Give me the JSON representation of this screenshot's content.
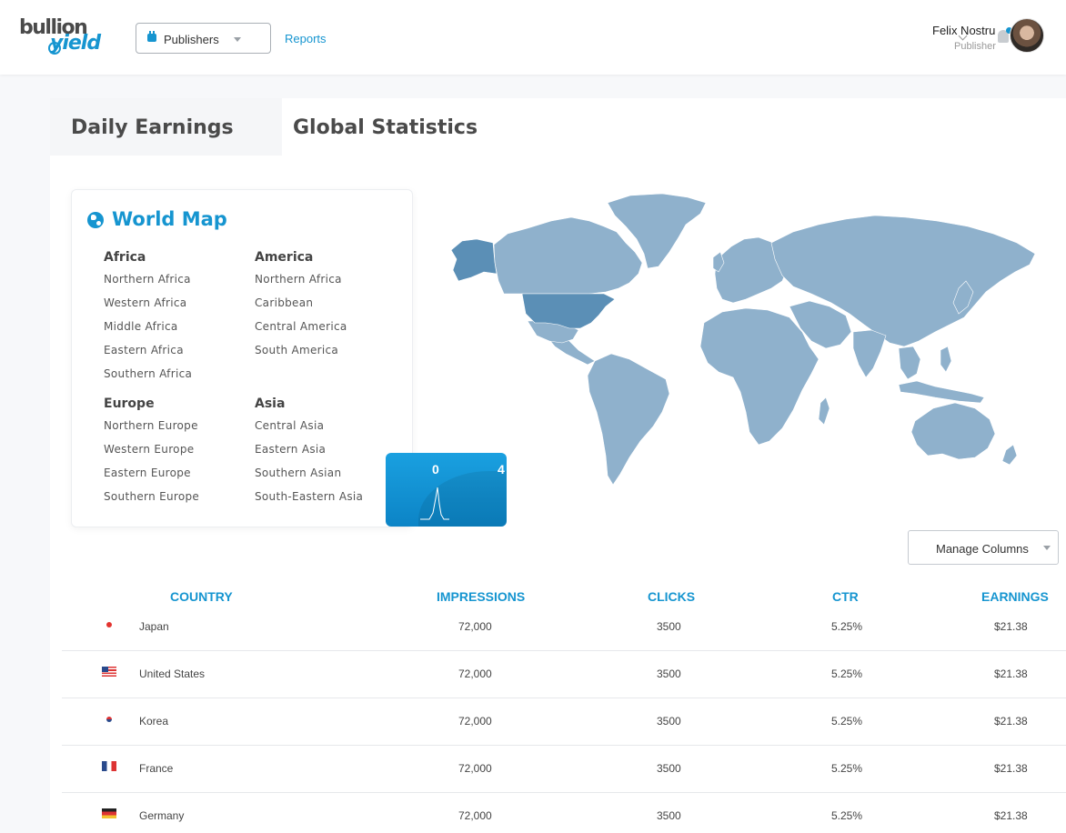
{
  "header": {
    "logo_top": "bullion",
    "logo_bottom": "yield",
    "publisher_select": "Publishers",
    "reports_link": "Reports",
    "user_name": "Felix Nostru",
    "user_role": "Publisher"
  },
  "tabs": [
    {
      "label": "Daily Earnings",
      "active": false
    },
    {
      "label": "Global Statistics",
      "active": true
    }
  ],
  "world_map": {
    "title": "World Map",
    "groups": [
      {
        "name": "Africa",
        "items": [
          "Northern Africa",
          "Western Africa",
          "Middle Africa",
          "Eastern Africa",
          "Southern Africa"
        ]
      },
      {
        "name": "America",
        "items": [
          "Northern Africa",
          "Caribbean",
          "Central America",
          "South America"
        ]
      },
      {
        "name": "Europe",
        "items": [
          "Northern Europe",
          "Western Europe",
          "Eastern Europe",
          "Southern Europe"
        ]
      },
      {
        "name": "Asia",
        "items": [
          "Central Asia",
          "Eastern Asia",
          "Southern Asian",
          "South-Eastern Asia"
        ]
      }
    ],
    "popup": {
      "left_value": "0",
      "right_value": "4"
    },
    "colors": {
      "land": "#8fb1cc",
      "highlight": "#5b8fb6",
      "accent": "#1695d0"
    }
  },
  "manage_columns": "Manage Columns",
  "table": {
    "columns": [
      "COUNTRY",
      "IMPRESSIONS",
      "CLICKS",
      "CTR",
      "EARNINGS"
    ],
    "rows": [
      {
        "flag": "japan-flag",
        "country": "Japan",
        "impressions": "72,000",
        "clicks": "3500",
        "ctr": "5.25%",
        "earnings": "$21.38"
      },
      {
        "flag": "usa-flag",
        "country": "United States",
        "impressions": "72,000",
        "clicks": "3500",
        "ctr": "5.25%",
        "earnings": "$21.38"
      },
      {
        "flag": "korea-flag",
        "country": "Korea",
        "impressions": "72,000",
        "clicks": "3500",
        "ctr": "5.25%",
        "earnings": "$21.38"
      },
      {
        "flag": "france-flag",
        "country": "France",
        "impressions": "72,000",
        "clicks": "3500",
        "ctr": "5.25%",
        "earnings": "$21.38"
      },
      {
        "flag": "germany-flag",
        "country": "Germany",
        "impressions": "72,000",
        "clicks": "3500",
        "ctr": "5.25%",
        "earnings": "$21.38"
      }
    ]
  }
}
